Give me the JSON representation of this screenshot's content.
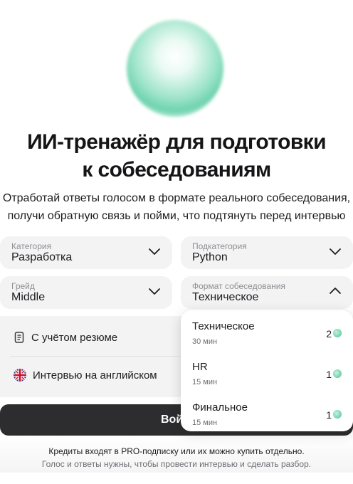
{
  "hero": {
    "title_line1": "ИИ-тренажёр для подготовки",
    "title_line2": "к собеседованиям",
    "subtitle_line1": "Отработай ответы голосом в формате реального собеседования,",
    "subtitle_line2": "получи обратную связь и пойми, что подтянуть перед интервью"
  },
  "form": {
    "category": {
      "label": "Категория",
      "value": "Разработка"
    },
    "subcategory": {
      "label": "Подкатегория",
      "value": "Python"
    },
    "grade": {
      "label": "Грейд",
      "value": "Middle"
    },
    "format": {
      "label": "Формат собеседования",
      "value": "Техническое"
    }
  },
  "options": {
    "resume_label": "С учётом резюме",
    "english_label": "Интервью на английском"
  },
  "dropdown": {
    "items": [
      {
        "name": "Техническое",
        "duration": "30 мин",
        "cost": "2"
      },
      {
        "name": "HR",
        "duration": "15 мин",
        "cost": "1"
      },
      {
        "name": "Финальное",
        "duration": "15 мин",
        "cost": "1"
      }
    ]
  },
  "start_button_label": "Вой",
  "footer": {
    "line1": "Кредиты входят в PRO-подписку или их можно купить отдельно.",
    "line2": "Голос и ответы нужны, чтобы провести интервью и сделать разбор."
  },
  "colors": {
    "accent": "#6fd3ae",
    "button": "#2d2d2f",
    "field_bg": "#f3f3f4"
  }
}
